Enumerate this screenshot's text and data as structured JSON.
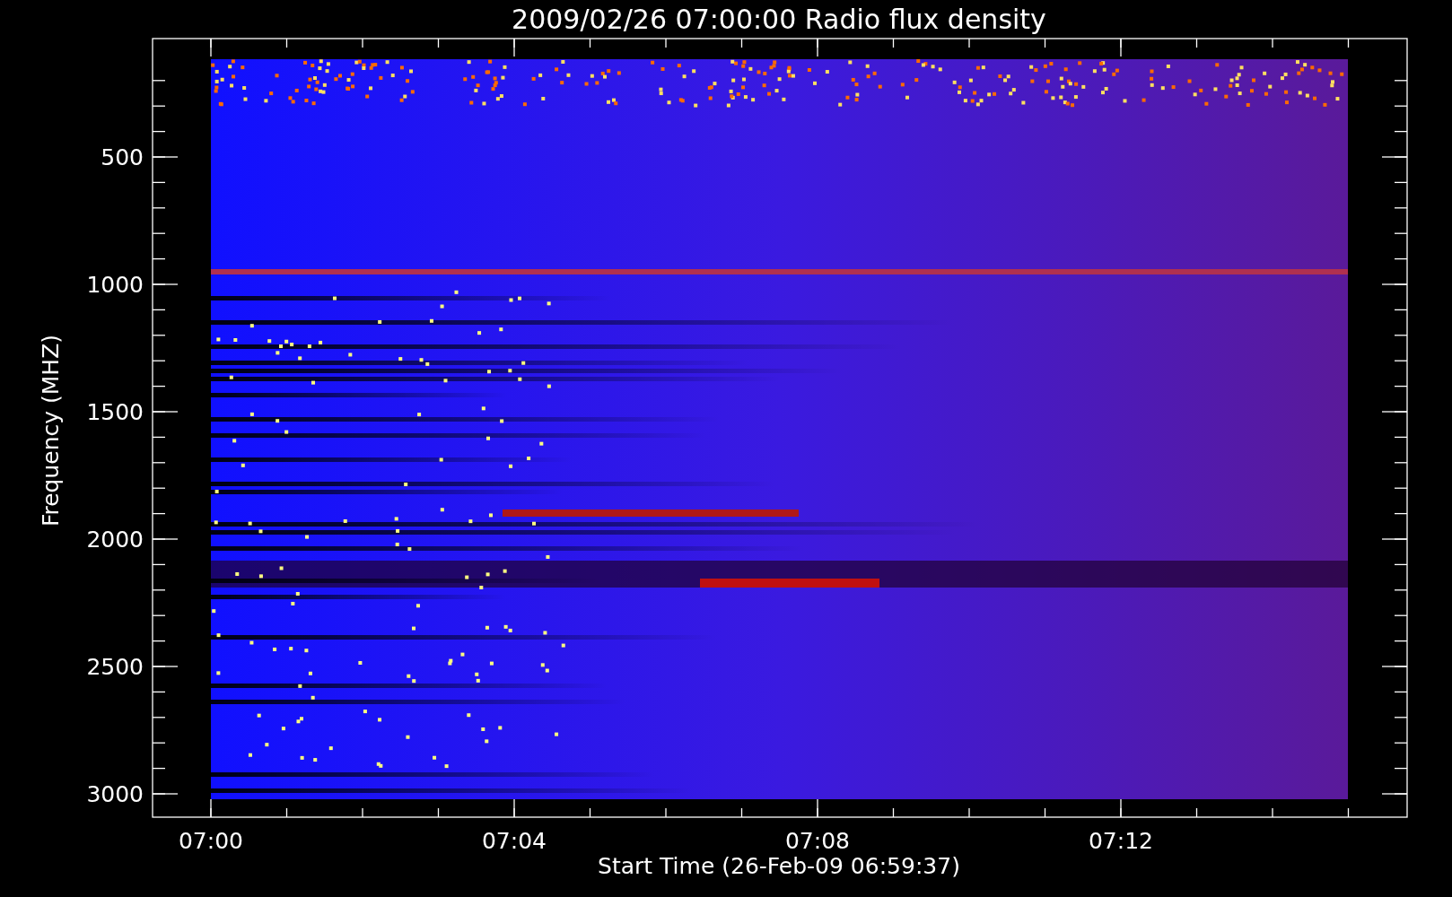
{
  "title": "2009/02/26 07:00:00 Radio flux density",
  "y_axis": {
    "label": "Frequency (MHZ)",
    "ticks": [
      "500",
      "1000",
      "1500",
      "2000",
      "2500",
      "3000"
    ]
  },
  "x_axis": {
    "label": "Start Time (26-Feb-09 06:59:37)",
    "ticks": [
      "07:00",
      "07:04",
      "07:08",
      "07:12"
    ]
  }
}
